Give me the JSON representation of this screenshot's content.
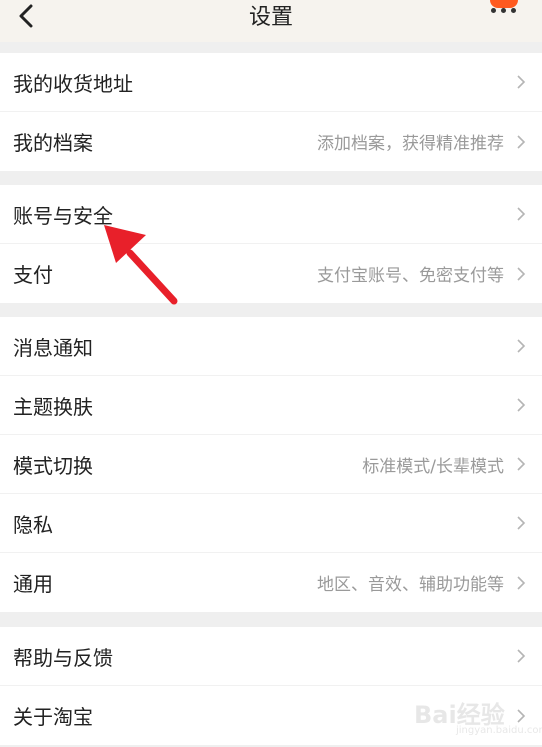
{
  "header": {
    "title": "设置",
    "back_icon": "chevron-left-icon",
    "more_icon": "more-dots-icon"
  },
  "groups": [
    {
      "items": [
        {
          "label": "我的收货地址",
          "hint": ""
        },
        {
          "label": "我的档案",
          "hint": "添加档案，获得精准推荐"
        }
      ]
    },
    {
      "items": [
        {
          "label": "账号与安全",
          "hint": ""
        },
        {
          "label": "支付",
          "hint": "支付宝账号、免密支付等"
        }
      ]
    },
    {
      "items": [
        {
          "label": "消息通知",
          "hint": ""
        },
        {
          "label": "主题换肤",
          "hint": ""
        },
        {
          "label": "模式切换",
          "hint": "标准模式/长辈模式"
        },
        {
          "label": "隐私",
          "hint": ""
        },
        {
          "label": "通用",
          "hint": "地区、音效、辅助功能等"
        }
      ]
    },
    {
      "items": [
        {
          "label": "帮助与反馈",
          "hint": ""
        },
        {
          "label": "关于淘宝",
          "hint": ""
        }
      ]
    }
  ],
  "watermark": {
    "text": "Bai经验",
    "sub": "jingyan.baidu.com"
  },
  "colors": {
    "accent_badge": "#ff5a1f",
    "annotation_arrow": "#e8202a",
    "background": "#efefef"
  }
}
